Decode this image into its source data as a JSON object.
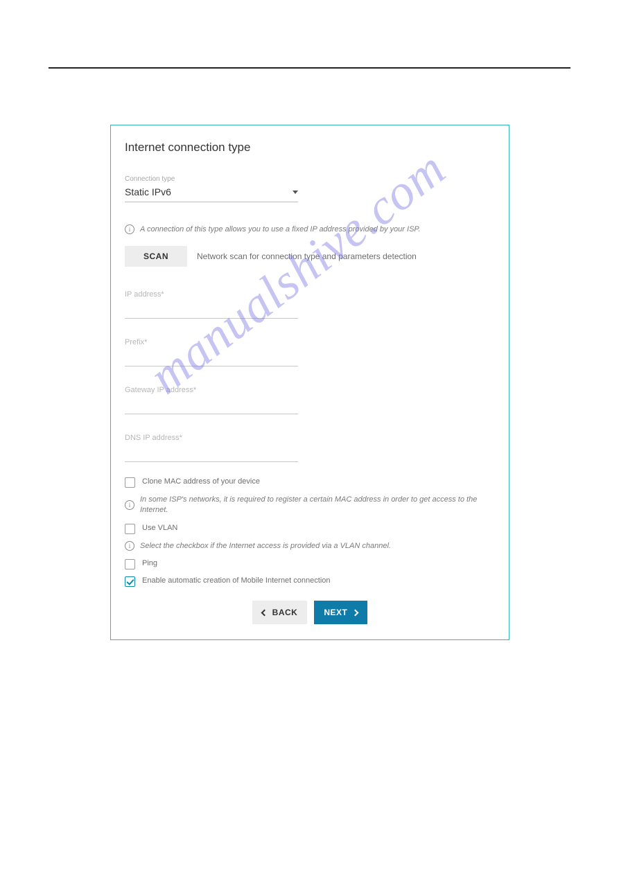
{
  "watermark": "manualshive.com",
  "panel": {
    "title": "Internet connection type",
    "connection_type": {
      "label": "Connection type",
      "value": "Static IPv6"
    },
    "description": "A connection of this type allows you to use a fixed IP address provided by your ISP.",
    "scan": {
      "label": "SCAN",
      "help": "Network scan for connection type and parameters detection"
    },
    "fields": {
      "ip_label": "IP address*",
      "prefix_label": "Prefix*",
      "gateway_label": "Gateway IP address*",
      "dns_label": "DNS IP address*"
    },
    "clone_mac": {
      "label": "Clone MAC address of your device"
    },
    "mac_help": "In some ISP's networks, it is required to register a certain MAC address in order to get access to the Internet.",
    "use_vlan": {
      "label": "Use VLAN"
    },
    "vlan_help": "Select the checkbox if the Internet access is provided via a VLAN channel.",
    "ping": {
      "label": "Ping"
    },
    "auto_mobile": {
      "label": "Enable automatic creation of Mobile Internet connection"
    },
    "buttons": {
      "back": "BACK",
      "next": "NEXT"
    }
  }
}
